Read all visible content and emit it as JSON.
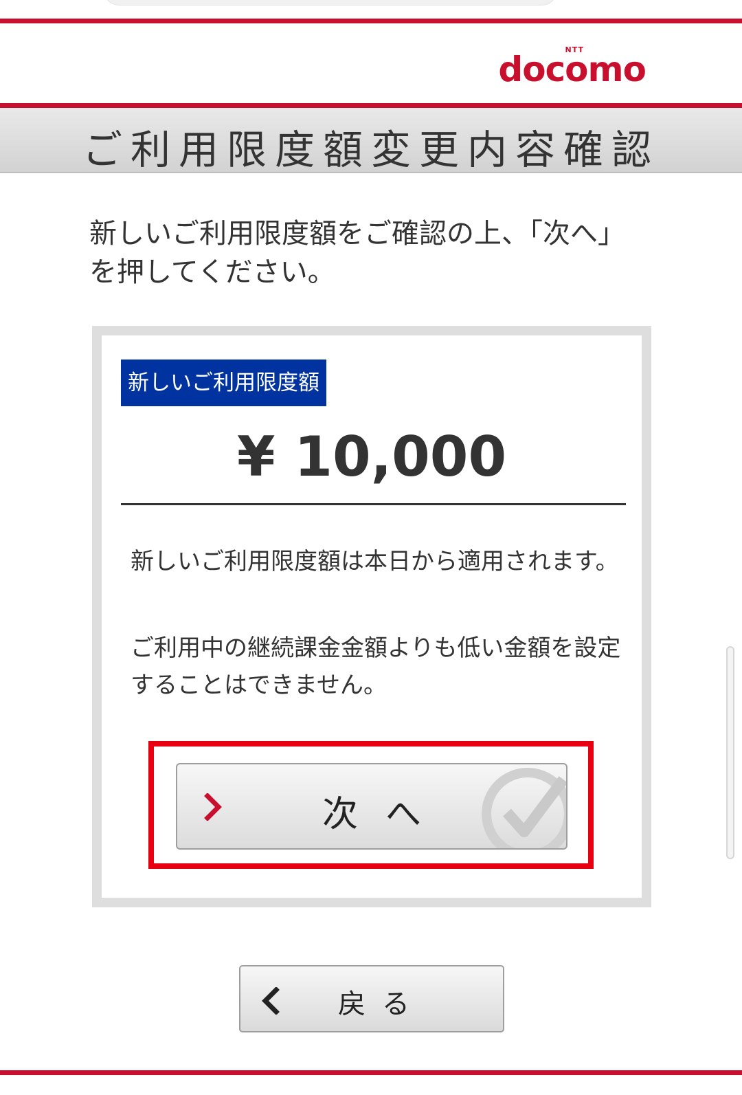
{
  "brand": {
    "logo_text": "docomo",
    "logo_ntt": "NTT",
    "accent_color": "#c8102e"
  },
  "header": {
    "title": "ご利用限度額変更内容確認"
  },
  "instruction": "新しいご利用限度額をご確認の上、「次へ」を押してください。",
  "card": {
    "badge_label": "新しいご利用限度額",
    "badge_color": "#0033a0",
    "amount": "¥ 10,000",
    "note1": "新しいご利用限度額は本日から適用されます。",
    "note2": "ご利用中の継続課金金額よりも低い金額を設定することはできません。"
  },
  "buttons": {
    "next_label": "次へ",
    "back_label": "戻る",
    "next_icon": "chevron-right-icon",
    "back_icon": "chevron-left-icon",
    "check_icon": "check-circle-icon"
  },
  "highlight_color": "#e60012"
}
